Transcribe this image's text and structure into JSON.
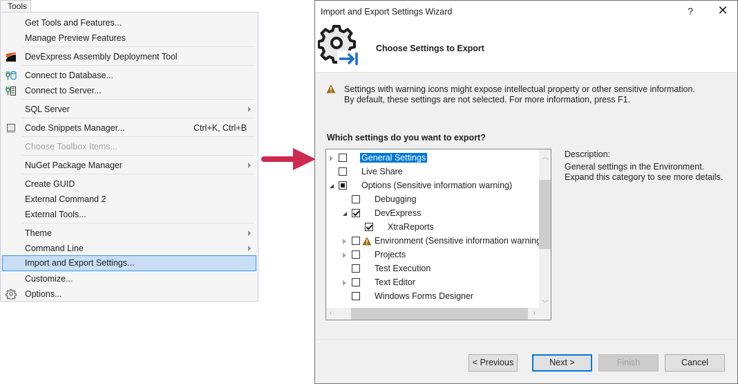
{
  "menu": {
    "tab_label": "Tools",
    "items": [
      {
        "label": "Get Tools and Features...",
        "icon": null
      },
      {
        "label": "Manage Preview Features",
        "icon": null
      },
      {
        "label": "DevExpress Assembly Deployment Tool",
        "icon": "devexpress-logo-icon"
      },
      {
        "label": "Connect to Database...",
        "icon": "connect-database-icon"
      },
      {
        "label": "Connect to Server...",
        "icon": "connect-server-icon"
      },
      {
        "label": "SQL Server",
        "submenu": true
      },
      {
        "label": "Code Snippets Manager...",
        "shortcut": "Ctrl+K, Ctrl+B",
        "icon": "code-snippets-icon"
      },
      {
        "label": "Choose Toolbox Items...",
        "disabled": true
      },
      {
        "label": "NuGet Package Manager",
        "submenu": true
      },
      {
        "label": "Create GUID"
      },
      {
        "label": "External Command 2"
      },
      {
        "label": "External Tools..."
      },
      {
        "label": "Theme",
        "submenu": true
      },
      {
        "label": "Command Line",
        "submenu": true
      },
      {
        "label": "Import and Export Settings...",
        "highlighted": true
      },
      {
        "label": "Customize..."
      },
      {
        "label": "Options...",
        "icon": "gear-icon"
      }
    ]
  },
  "arrow_color": "#cc2a4e",
  "dialog": {
    "title": "Import and Export Settings Wizard",
    "help_label": "?",
    "close_label": "✕",
    "header_title": "Choose Settings to Export",
    "warning_text": "Settings with warning icons might expose intellectual property or other sensitive information. By default, these settings are not selected. For more information, press F1.",
    "question": "Which settings do you want to export?",
    "tree": [
      {
        "label": "General Settings",
        "level": 0,
        "expander": "closed",
        "state": "unchecked",
        "selected": true
      },
      {
        "label": "Live Share",
        "level": 0,
        "expander": null,
        "state": "unchecked"
      },
      {
        "label": "Options (Sensitive information warning)",
        "level": 0,
        "expander": "open",
        "state": "partial"
      },
      {
        "label": "Debugging",
        "level": 1,
        "expander": null,
        "state": "unchecked"
      },
      {
        "label": "DevExpress",
        "level": 1,
        "expander": "open",
        "state": "checked"
      },
      {
        "label": "XtraReports",
        "level": 2,
        "expander": null,
        "state": "checked"
      },
      {
        "label": "Environment (Sensitive information warning)",
        "level": 1,
        "expander": "closed",
        "state": "unchecked",
        "warning": true
      },
      {
        "label": "Projects",
        "level": 1,
        "expander": "closed",
        "state": "unchecked"
      },
      {
        "label": "Test Execution",
        "level": 1,
        "expander": null,
        "state": "unchecked"
      },
      {
        "label": "Text Editor",
        "level": 1,
        "expander": "closed",
        "state": "unchecked"
      },
      {
        "label": "Windows Forms Designer",
        "level": 1,
        "expander": null,
        "state": "unchecked"
      }
    ],
    "description_label": "Description:",
    "description_text": "General settings in the Environment. Expand this category to see more details.",
    "buttons": {
      "previous": "< Previous",
      "next": "Next >",
      "finish": "Finish",
      "cancel": "Cancel"
    }
  }
}
